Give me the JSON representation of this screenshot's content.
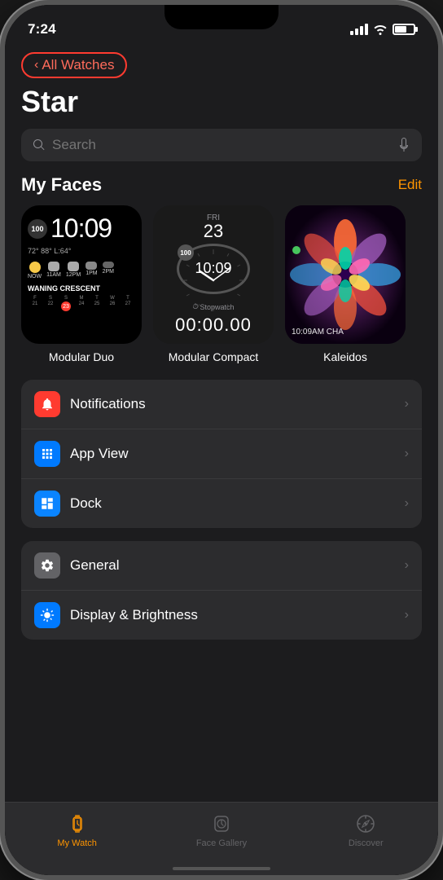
{
  "statusBar": {
    "time": "7:24",
    "locationArrow": "▶"
  },
  "topNav": {
    "allWatchesLabel": "All Watches",
    "chevronLeft": "‹"
  },
  "pageTitle": "Star",
  "searchBar": {
    "placeholder": "Search"
  },
  "myFaces": {
    "sectionTitle": "My Faces",
    "editLabel": "Edit",
    "faces": [
      {
        "id": "modular-duo",
        "label": "Modular Duo",
        "time": "10:09",
        "badge": "100",
        "weatherTemp": "72°",
        "tempRange": "88° L:64°"
      },
      {
        "id": "modular-compact",
        "label": "Modular Compact",
        "time": "10:09",
        "badge": "100",
        "dayLabel": "FRI",
        "dateLabel": "23",
        "stopwatchLabel": "Stopwatch",
        "stopwatchTime": "00:00.00"
      },
      {
        "id": "kaleidoscope",
        "label": "Kaleidos",
        "timeLabel": "10:09AM CHA"
      }
    ]
  },
  "settingsGroups": [
    {
      "id": "group1",
      "items": [
        {
          "id": "notifications",
          "icon": "bell",
          "iconBg": "red",
          "label": "Notifications"
        },
        {
          "id": "app-view",
          "icon": "grid",
          "iconBg": "blue",
          "label": "App View"
        },
        {
          "id": "dock",
          "icon": "dock",
          "iconBg": "blue-dark",
          "label": "Dock"
        }
      ]
    },
    {
      "id": "group2",
      "items": [
        {
          "id": "general",
          "icon": "gear",
          "iconBg": "gray",
          "label": "General"
        },
        {
          "id": "display-brightness",
          "icon": "sun",
          "iconBg": "blue-bright",
          "label": "Display & Brightness"
        }
      ]
    }
  ],
  "tabBar": {
    "tabs": [
      {
        "id": "my-watch",
        "label": "My Watch",
        "icon": "watch",
        "active": true
      },
      {
        "id": "face-gallery",
        "label": "Face Gallery",
        "icon": "face",
        "active": false
      },
      {
        "id": "discover",
        "label": "Discover",
        "icon": "compass",
        "active": false
      }
    ]
  }
}
